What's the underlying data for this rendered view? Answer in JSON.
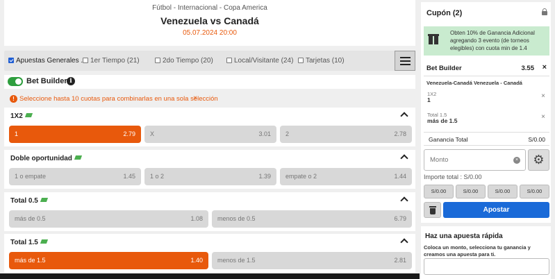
{
  "match": {
    "competition": "Fútbol - Internacional - Copa America",
    "teams": "Venezuela vs Canadá",
    "datetime": "05.07.2024 20:00"
  },
  "filters": [
    {
      "label": "Apuestas Generales ...",
      "checked": true
    },
    {
      "label": "1er Tiempo (21)",
      "checked": false
    },
    {
      "label": "2do Tiempo (20)",
      "checked": false
    },
    {
      "label": "Local/Visitante (24)",
      "checked": false
    },
    {
      "label": "Tarjetas (10)",
      "checked": false
    }
  ],
  "bet_builder": {
    "label": "Bet Builder",
    "enabled": true
  },
  "notice": {
    "text": "Seleccione hasta 10 cuotas para combinarlas en una sola selección",
    "close": "×"
  },
  "markets": [
    {
      "title": "1X2",
      "odds": [
        {
          "label": "1",
          "value": "2.79",
          "selected": true
        },
        {
          "label": "X",
          "value": "3.01",
          "selected": false
        },
        {
          "label": "2",
          "value": "2.78",
          "selected": false
        }
      ]
    },
    {
      "title": "Doble oportunidad",
      "odds": [
        {
          "label": "1 o empate",
          "value": "1.45",
          "selected": false
        },
        {
          "label": "1 o 2",
          "value": "1.39",
          "selected": false
        },
        {
          "label": "empate o 2",
          "value": "1.44",
          "selected": false
        }
      ]
    },
    {
      "title": "Total 0.5",
      "odds": [
        {
          "label": "más de 0.5",
          "value": "1.08",
          "selected": false
        },
        {
          "label": "menos de 0.5",
          "value": "6.79",
          "selected": false
        }
      ]
    },
    {
      "title": "Total 1.5",
      "odds": [
        {
          "label": "más de 1.5",
          "value": "1.40",
          "selected": true
        },
        {
          "label": "menos de 1.5",
          "value": "2.81",
          "selected": false
        }
      ]
    }
  ],
  "coupon": {
    "title": "Cupón (2)",
    "promo": "Obten 10% de Ganancia Adicional agregando 3 evento (de torneos elegibles) con cuota min de 1.4",
    "builder_title": "Bet Builder",
    "builder_odds": "3.55",
    "close": "×",
    "event": "Venezuela-Canadá Venezuela - Canadá",
    "selections": [
      {
        "market": "1X2",
        "pick": "1",
        "remove": "×"
      },
      {
        "market": "Total 1.5",
        "pick": "más de 1.5",
        "remove": "×"
      }
    ],
    "gain_label": "Ganancia Total",
    "gain_value": "S/0.00",
    "amount_placeholder": "Monto",
    "total_label": "Importe total :  S/0.00",
    "quick_amounts": [
      "S/0.00",
      "S/0.00",
      "S/0.00",
      "S/0.00"
    ],
    "bet_button": "Apostar"
  },
  "quick_bet": {
    "title": "Haz una apuesta rápida",
    "text": "Coloca un monto, selecciona tu ganancia y creamos una apuesta para ti."
  },
  "colors": {
    "accent": "#e8590c",
    "primary": "#1a6ad8",
    "success": "#2e9e3e"
  }
}
